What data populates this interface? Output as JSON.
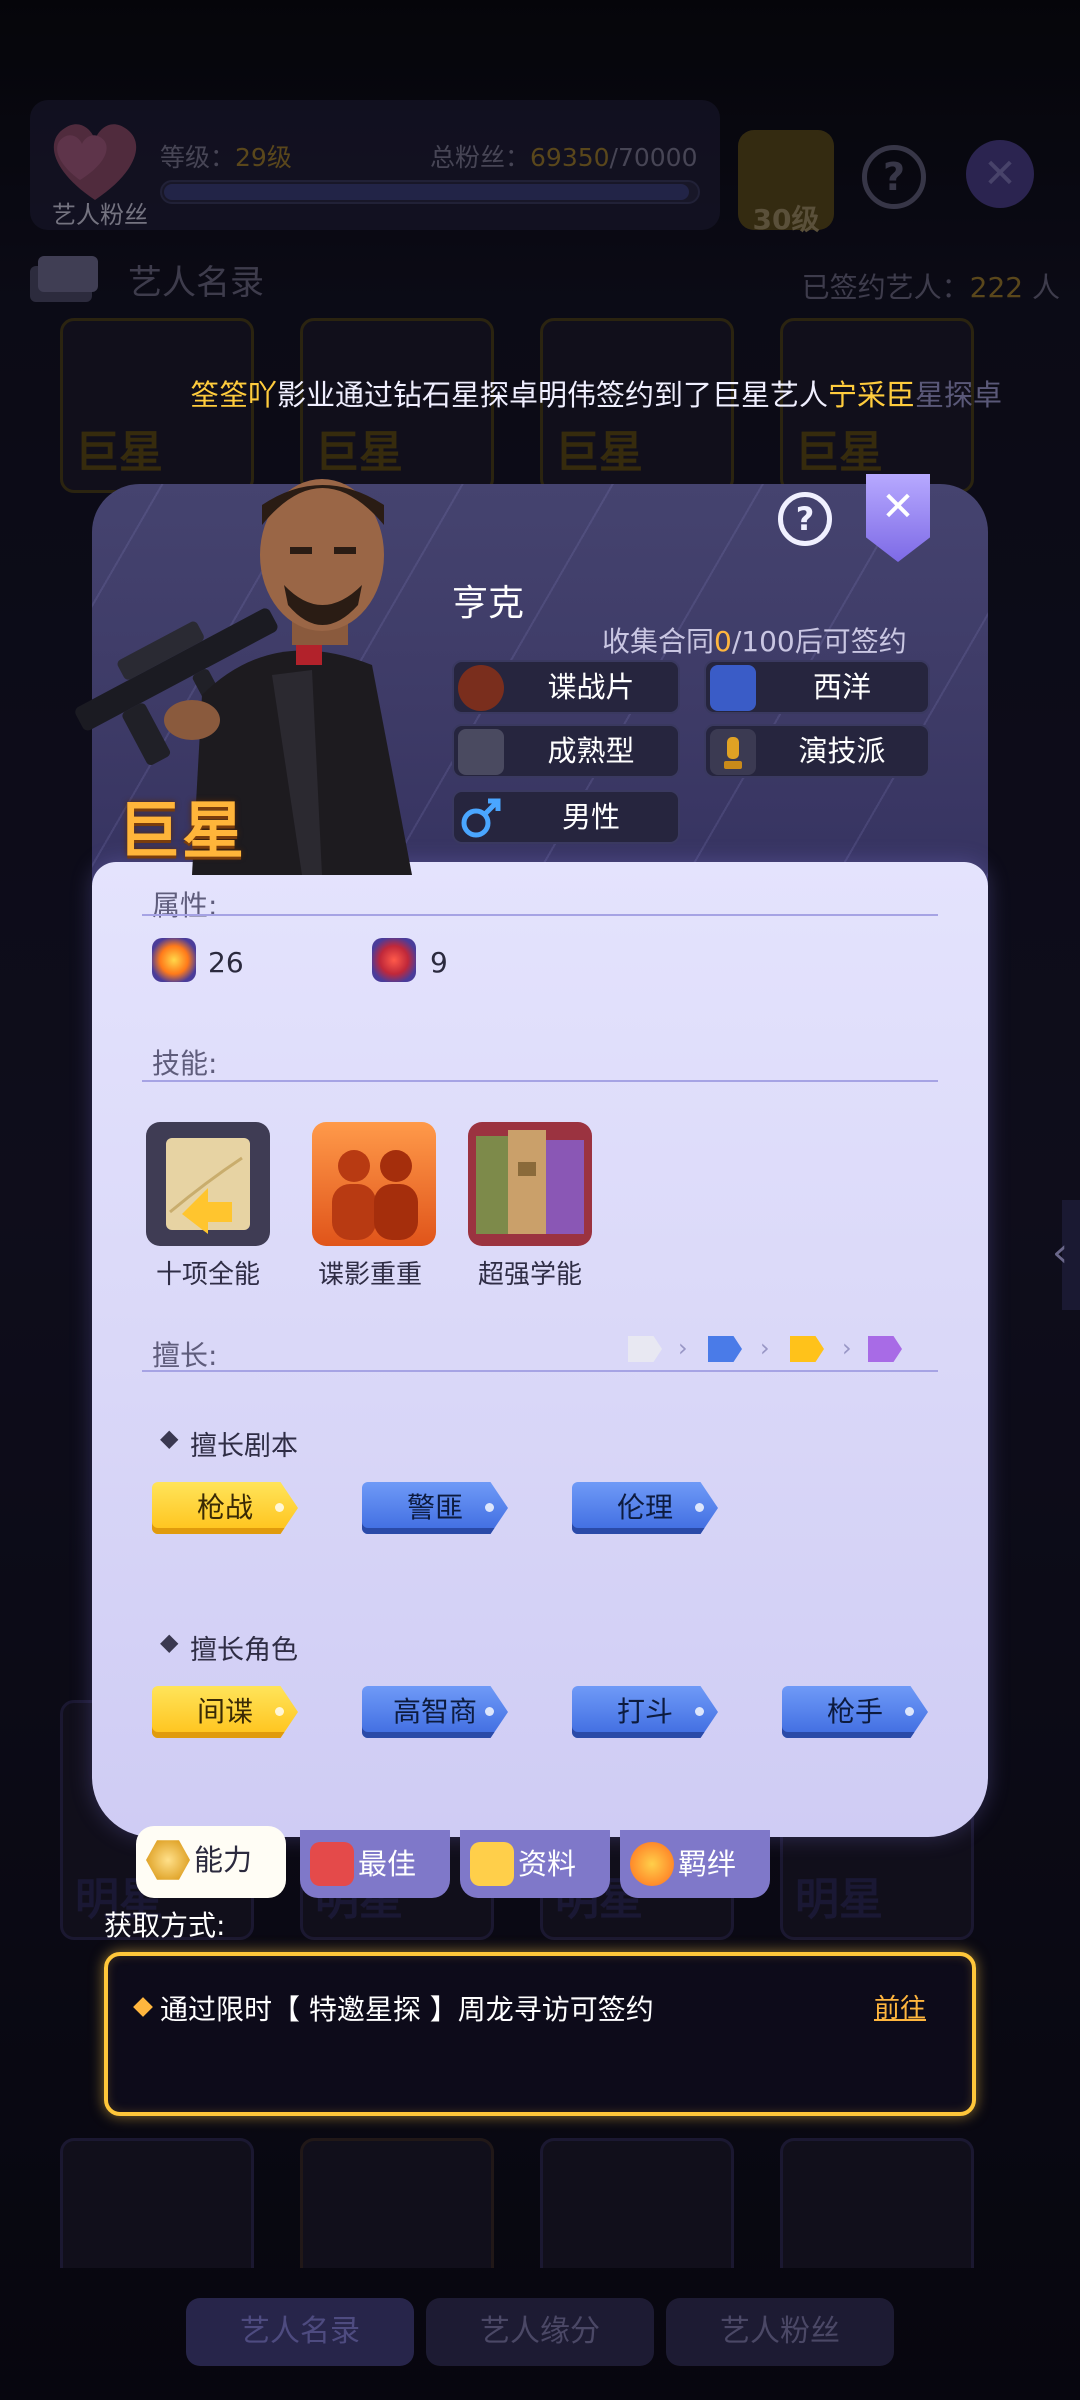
{
  "background": {
    "fan_label": "艺人粉丝",
    "level_label": "等级：",
    "level_value": "29级",
    "total_fans_label": "总粉丝：",
    "total_fans_value": "69350",
    "total_fans_max": "/70000",
    "next_level": "30级",
    "roster_title": "艺人名录",
    "signed_label": "已签约艺人：",
    "signed_count": "222",
    "signed_unit": "人",
    "card_rank_big": "巨星",
    "card_rank_small": "明星",
    "bottom_tabs": [
      "艺人名录",
      "艺人缘分",
      "艺人粉丝"
    ]
  },
  "news": {
    "player": "筌筌吖",
    "middle": "影业通过钻石星探卓明伟签约到了巨星艺人",
    "artist": "宁采臣",
    "tail": "星探卓"
  },
  "modal": {
    "help": "?",
    "rank": "巨星",
    "name": "亨克",
    "collect_prefix": "收集合同",
    "collect_current": "0",
    "collect_suffix": "/100后可签约",
    "tags": [
      {
        "label": "谍战片",
        "icon": "genre-spy-icon"
      },
      {
        "label": "西洋",
        "icon": "western-trees-icon"
      },
      {
        "label": "成熟型",
        "icon": "wine-glass-icon"
      },
      {
        "label": "演技派",
        "icon": "trophy-icon"
      },
      {
        "label": "男性",
        "icon": "male-symbol-icon"
      }
    ],
    "attributes_label": "属性:",
    "attributes": [
      {
        "icon": "explosion-attr-icon",
        "value": "26"
      },
      {
        "icon": "mask-attr-icon",
        "value": "9"
      }
    ],
    "skills_label": "技能:",
    "skills": [
      {
        "name": "十项全能",
        "icon": "envelope-skill-icon"
      },
      {
        "name": "谍影重重",
        "icon": "silhouettes-skill-icon"
      },
      {
        "name": "超强学能",
        "icon": "books-skill-icon"
      }
    ],
    "specialty_label": "擅长:",
    "script_label": "擅长剧本",
    "scripts": [
      {
        "label": "枪战",
        "color": "yellow"
      },
      {
        "label": "警匪",
        "color": "blue"
      },
      {
        "label": "伦理",
        "color": "blue"
      }
    ],
    "role_label": "擅长角色",
    "roles": [
      {
        "label": "间谍",
        "color": "yellow"
      },
      {
        "label": "高智商",
        "color": "blue"
      },
      {
        "label": "打斗",
        "color": "blue"
      },
      {
        "label": "枪手",
        "color": "blue"
      }
    ],
    "tier_colors": [
      "#e8e8f2",
      "#4a7be8",
      "#ffc21a",
      "#a86be6"
    ]
  },
  "bottom_tabs": [
    {
      "label": "能力",
      "active": true
    },
    {
      "label": "最佳",
      "active": false
    },
    {
      "label": "资料",
      "active": false
    },
    {
      "label": "羁绊",
      "active": false
    }
  ],
  "acquire": {
    "label": "获取方式:",
    "text": "通过限时【 特邀星探 】周龙寻访可签约",
    "go": "前往"
  }
}
